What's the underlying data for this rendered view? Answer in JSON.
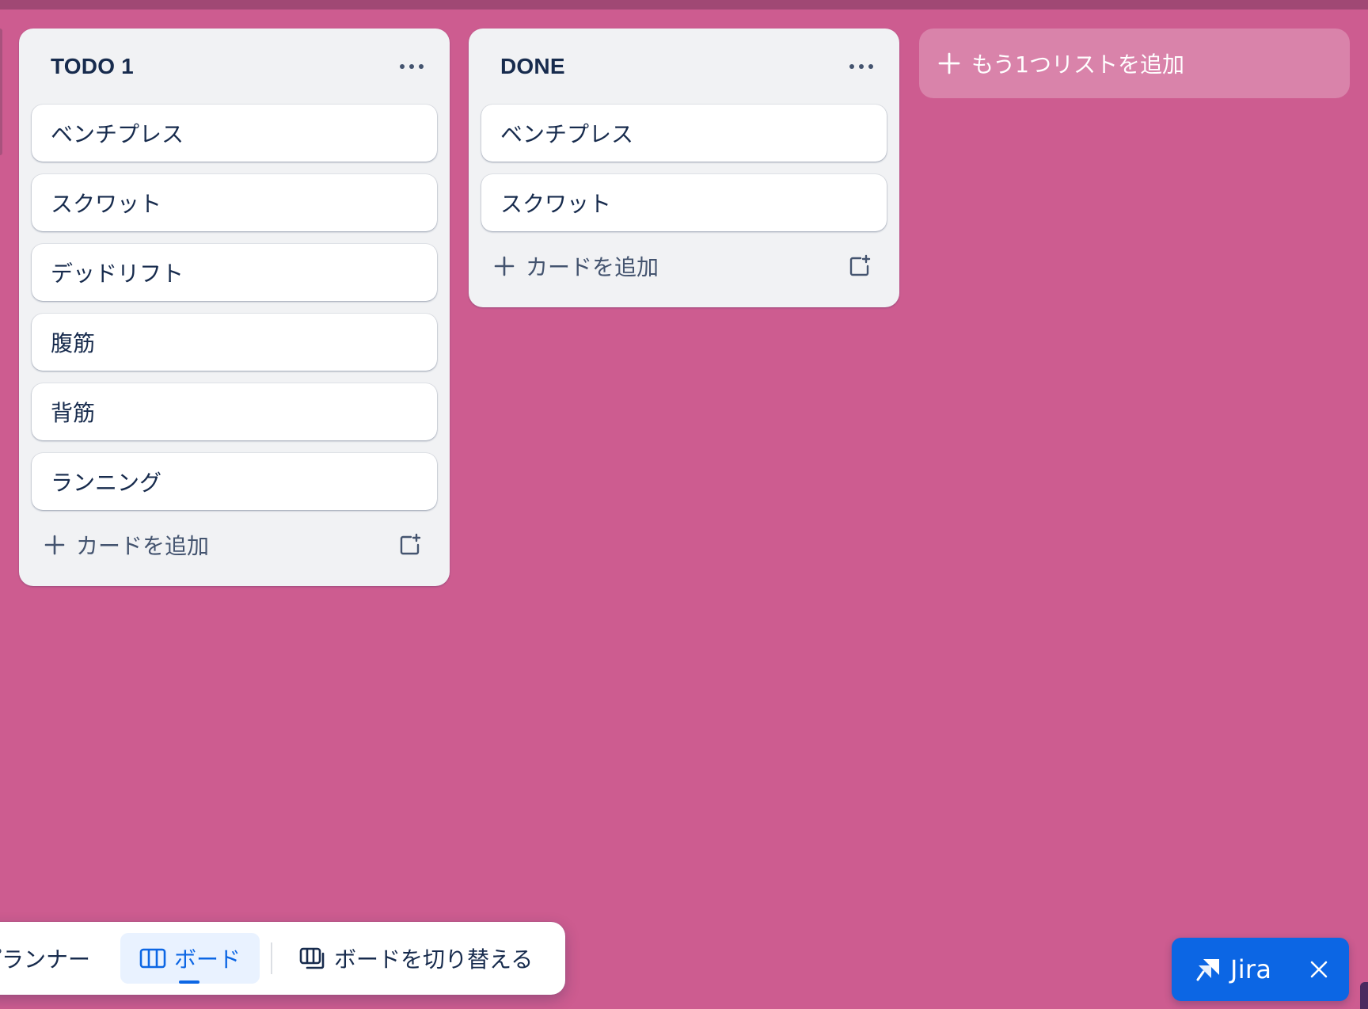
{
  "lists": [
    {
      "title": "TODO 1",
      "cards": [
        "ベンチプレス",
        "スクワット",
        "デッドリフト",
        "腹筋",
        "背筋",
        "ランニング"
      ],
      "add_card_label": "カードを追加"
    },
    {
      "title": "DONE",
      "cards": [
        "ベンチプレス",
        "スクワット"
      ],
      "add_card_label": "カードを追加"
    }
  ],
  "add_list_label": "もう1つリストを追加",
  "view_bar": {
    "planner_label": "プランナー",
    "board_label": "ボード",
    "switch_label": "ボードを切り替える"
  },
  "jira": {
    "label": "Jira"
  },
  "colors": {
    "background": "#cd5c90",
    "list_bg": "#f1f2f4",
    "accent_blue": "#0c66e4",
    "text": "#172b4d"
  },
  "icons": {
    "list_menu": "more-horizontal-icon",
    "add": "plus-icon",
    "template": "card-template-icon",
    "board_view": "board-columns-icon",
    "switch_boards": "switch-boards-icon",
    "jira": "jira-logo-icon",
    "close": "close-icon"
  }
}
